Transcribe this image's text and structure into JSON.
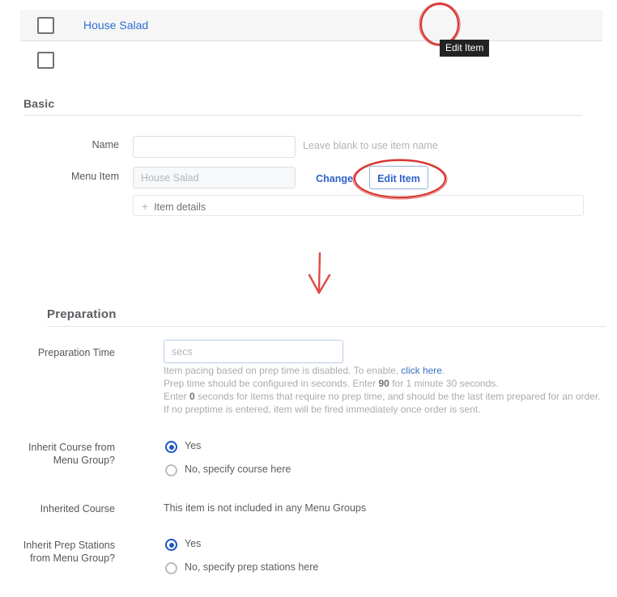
{
  "list": {
    "rows": [
      {
        "title": "House Salad",
        "checked": false
      },
      {
        "title": "",
        "checked": false
      }
    ],
    "icons": {
      "arrow": "→",
      "pencil": "✎",
      "price": "$"
    },
    "tooltip": "Edit Item"
  },
  "basic": {
    "title": "Basic",
    "name": {
      "label": "Name",
      "value": "",
      "placeholder": "",
      "hint": "Leave blank to use item name"
    },
    "menu_item": {
      "label": "Menu Item",
      "value": "",
      "placeholder": "House Salad",
      "change_label": "Change Item",
      "edit_label": "Edit Item"
    },
    "item_details": {
      "plus": "+",
      "label": "Item details"
    }
  },
  "preparation": {
    "title": "Preparation",
    "prep_time": {
      "label": "Preparation Time",
      "value": "",
      "placeholder": "secs"
    },
    "help": {
      "line1_pre": "Item pacing based on prep time is disabled. To enable, ",
      "line1_link": "click here",
      "line1_post": ".",
      "line2_pre": "Prep time should be configured in seconds. Enter ",
      "line2_bold": "90",
      "line2_post": " for 1 minute 30 seconds.",
      "line3_pre": "Enter ",
      "line3_bold": "0",
      "line3_post": " seconds for items that require no prep time, and should be the last item prepared for an order.",
      "line4": "If no preptime is entered, item will be fired immediately once order is sent."
    },
    "inherit_course": {
      "label_line1": "Inherit Course from",
      "label_line2": "Menu Group?",
      "yes_label": "Yes",
      "no_label": "No, specify course here",
      "selected": "yes"
    },
    "inherited_course": {
      "label": "Inherited Course",
      "value": "This item is not included in any Menu Groups"
    },
    "inherit_prep_stations": {
      "label_line1": "Inherit Prep Stations",
      "label_line2": "from Menu Group?",
      "yes_label": "Yes",
      "no_label": "No, specify prep stations here",
      "selected": "yes"
    }
  },
  "annotations": {
    "circle_arrow_color": "#d8342f",
    "circle_edit_color": "#d8342f",
    "down_arrow_color": "#e04a42"
  }
}
